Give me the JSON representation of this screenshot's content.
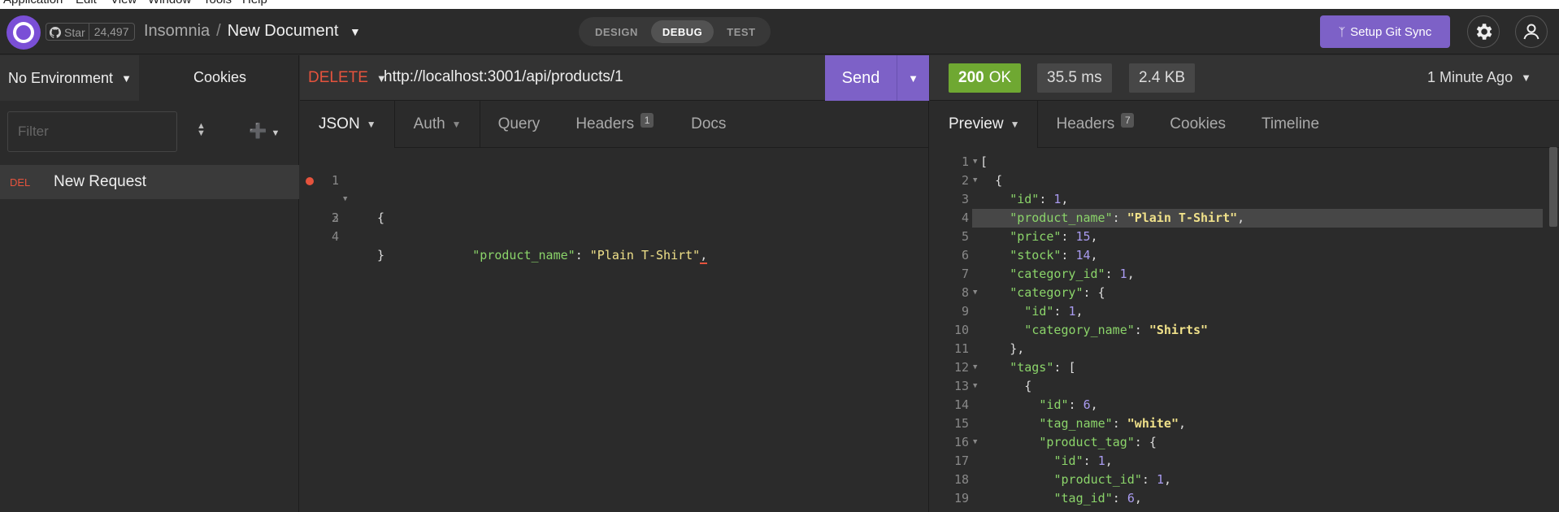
{
  "menubar": [
    "Application",
    "Edit",
    "View",
    "Window",
    "Tools",
    "Help"
  ],
  "header": {
    "github_star_label": "Star",
    "github_star_count": "24,497",
    "workspace": "Insomnia",
    "separator": "/",
    "document": "New Document",
    "modes": [
      "DESIGN",
      "DEBUG",
      "TEST"
    ],
    "active_mode": "DEBUG",
    "git_sync_label": "Setup Git Sync"
  },
  "sidebar": {
    "environment": "No Environment",
    "cookies_label": "Cookies",
    "filter_placeholder": "Filter",
    "requests": [
      {
        "method": "DEL",
        "name": "New Request"
      }
    ]
  },
  "request": {
    "method": "DELETE",
    "url": "http://localhost:3001/api/products/1",
    "send_label": "Send",
    "tabs": [
      {
        "label": "JSON",
        "dropdown": true,
        "active": true
      },
      {
        "label": "Auth",
        "dropdown": true
      },
      {
        "label": "Query"
      },
      {
        "label": "Headers",
        "badge": "1"
      },
      {
        "label": "Docs"
      }
    ],
    "body_lines": [
      {
        "n": "1",
        "text": "{"
      },
      {
        "n": "2",
        "key": "\"product_name\"",
        "sep": ": ",
        "value": "\"Plain T-Shirt\"",
        "tail": ","
      },
      {
        "n": "3",
        "text": ""
      },
      {
        "n": "4",
        "text": "}"
      }
    ]
  },
  "response": {
    "status_code": "200",
    "status_text": "OK",
    "time": "35.5 ms",
    "size": "2.4 KB",
    "timestamp": "1 Minute Ago",
    "tabs": [
      {
        "label": "Preview",
        "dropdown": true,
        "active": true
      },
      {
        "label": "Headers",
        "badge": "7"
      },
      {
        "label": "Cookies"
      },
      {
        "label": "Timeline"
      }
    ]
  },
  "colors": {
    "accent": "#7d61c7",
    "delete": "#e5533d",
    "ok": "#6fa832"
  }
}
